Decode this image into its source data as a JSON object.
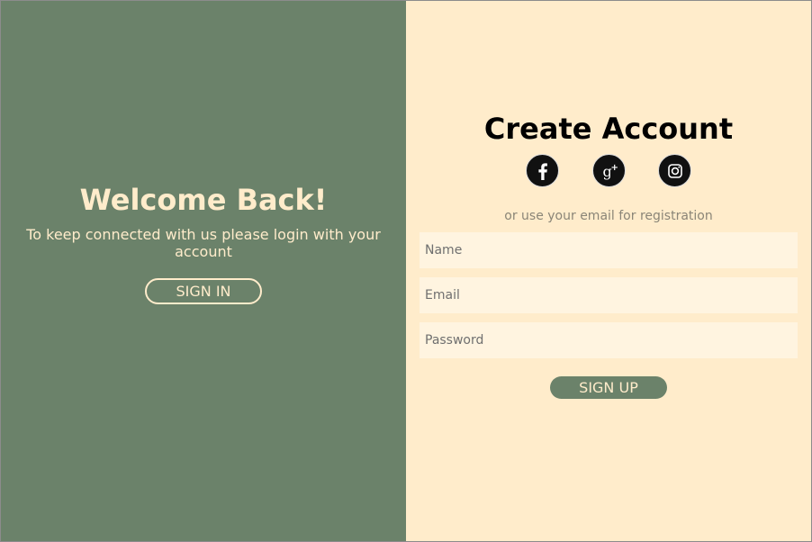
{
  "overlay": {
    "title": "Welcome Back!",
    "message": "To keep connected with us please login with your account",
    "sign_in_label": "SIGN IN"
  },
  "signup": {
    "title": "Create Account",
    "social": [
      {
        "name": "facebook",
        "icon": "facebook-icon"
      },
      {
        "name": "google-plus",
        "icon": "google-plus-icon"
      },
      {
        "name": "instagram",
        "icon": "instagram-icon"
      }
    ],
    "alt_text": "or use your email for registration",
    "fields": {
      "name_placeholder": "Name",
      "email_placeholder": "Email",
      "password_placeholder": "Password"
    },
    "sign_up_label": "SIGN UP"
  },
  "colors": {
    "green": "#6b826a",
    "cream": "#ffeccb",
    "input_bg": "#fff4e0"
  }
}
